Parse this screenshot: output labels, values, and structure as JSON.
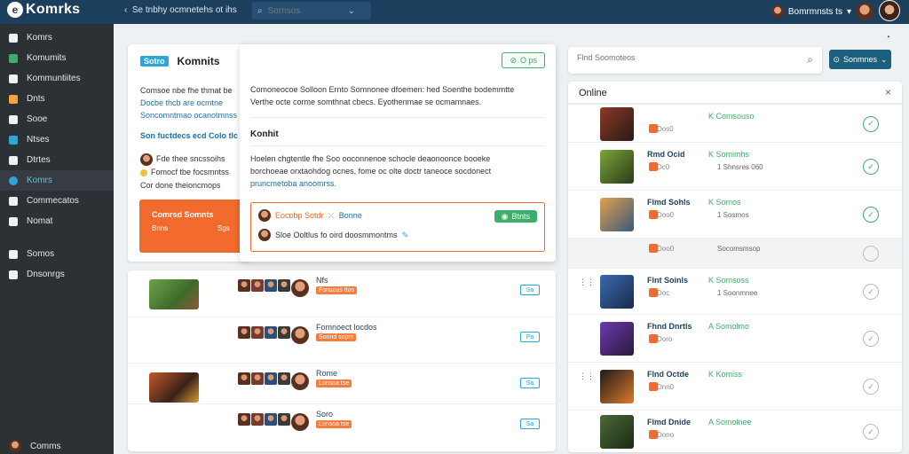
{
  "topbar": {
    "logo_text": "Komrks",
    "breadcrumb": "Se tnbhy ocmnetehs ot ihs",
    "search_placeholder": "Sornsos",
    "user_name": "Bomrmnsts ts"
  },
  "sidebar": {
    "items": [
      {
        "label": "Komrs",
        "color": "#f0f0f0"
      },
      {
        "label": "Komumits",
        "color": "#3dae6b"
      },
      {
        "label": "Kommuntiites",
        "color": "#f0f0f0"
      },
      {
        "label": "Dnts",
        "color": "#f2a33a"
      },
      {
        "label": "Sooe",
        "color": "#f0f0f0"
      },
      {
        "label": "Ntses",
        "color": "#2aa7d8"
      },
      {
        "label": "Dtrtes",
        "color": "#f0f0f0"
      },
      {
        "label": "Komrs",
        "color": "#2aa7d8"
      },
      {
        "label": "Commecatos",
        "color": "#f0f0f0"
      },
      {
        "label": "Nomat",
        "color": "#f0f0f0"
      },
      {
        "label": "Somos",
        "color": "#f0f0f0"
      },
      {
        "label": "Dnsonrgs",
        "color": "#f0f0f0"
      }
    ],
    "active_index": 7,
    "footer_label": "Comms"
  },
  "main_card": {
    "tag": "Sotro",
    "title": "Komnits",
    "body_lines": [
      "Comsoe nbe fhe thmat be",
      "Docbe thcb are ocmtne",
      "Soncomntmao ocanotmnss"
    ],
    "link_text": "Son fuctdecs ecd Colo tlc",
    "notes": [
      "Fde thee sncssoihs",
      "Fomocf tbe focsmntss",
      "Cor done theioncmops"
    ],
    "cta_title": "Comrsd Somnts",
    "cta_left": "Bnns",
    "cta_right": "Sgs"
  },
  "popup": {
    "button_label": "O ps",
    "line1": "Comoneocoe Solloon Ernto Somnonee dfoemen: hed Soenthe bodemmtte",
    "line2": "Verthe octe corme somthnat cbecs. Eyothenmae se ocmamnaes.",
    "section_title": "Konhit",
    "para1": "Hoelen chgtentle fhe Soo ooconnenoe schocle deaonoonce booeke",
    "para2": "borchoeae orxtaohdog ocnes, fome oc olte doctr taneoce socdonect",
    "para3": "pruncmetoba anoomrss.",
    "item1_text": "Eocobp Sotdr",
    "item1_link": "Bonne",
    "item1_badge": "Btnts",
    "item2_text": "Sloe Ooltlus fo oird doosmmontms"
  },
  "feed": {
    "rows": [
      {
        "title": "Nfs",
        "pill": "Fonsoas ttos",
        "button": "Sa"
      },
      {
        "title": "Fomnoect locdos",
        "pill": "Sonnd sopm",
        "button": "Pa"
      },
      {
        "title": "Rome",
        "pill": "Lonsoa tse",
        "button": "Sa"
      },
      {
        "title": "Soro",
        "pill": "Lonsoa tse",
        "button": "Sa"
      }
    ]
  },
  "right_panel": {
    "search_placeholder": "Flnd Soomoteos",
    "filter_label": "Sonmnes",
    "online_title": "Online",
    "friends": [
      {
        "name": "",
        "sub": "Dos0",
        "stat": "K Comsouso",
        "stat2": "",
        "check": "✓"
      },
      {
        "name": "Rmd Ocid",
        "sub": "Dc0",
        "stat": "K Somimhs",
        "stat2": "1 Shnsres 060",
        "check": "✓"
      },
      {
        "name": "Flmd Sohls",
        "sub": "Doo0",
        "stat": "K Somos",
        "stat2": "1 Sosmos",
        "check": "✓"
      },
      {
        "name": "",
        "sub": "Doo0",
        "stat": "",
        "stat2": "Socomsmsop",
        "check": ""
      },
      {
        "name": "Flnt Soinls",
        "sub": "Doc",
        "stat": "K Somsoss",
        "stat2": "1 Soonmnee",
        "check": "✓"
      },
      {
        "name": "Fhnd Dnrtls",
        "sub": "Doro",
        "stat": "A Somolmo",
        "stat2": "",
        "check": "✓"
      },
      {
        "name": "Flnd Octde",
        "sub": "Dnn0",
        "stat": "K Komiss",
        "stat2": "",
        "check": "✓"
      },
      {
        "name": "Flmd Dnide",
        "sub": "Dono",
        "stat": "A Somolnee",
        "stat2": "",
        "check": "✓"
      }
    ]
  }
}
